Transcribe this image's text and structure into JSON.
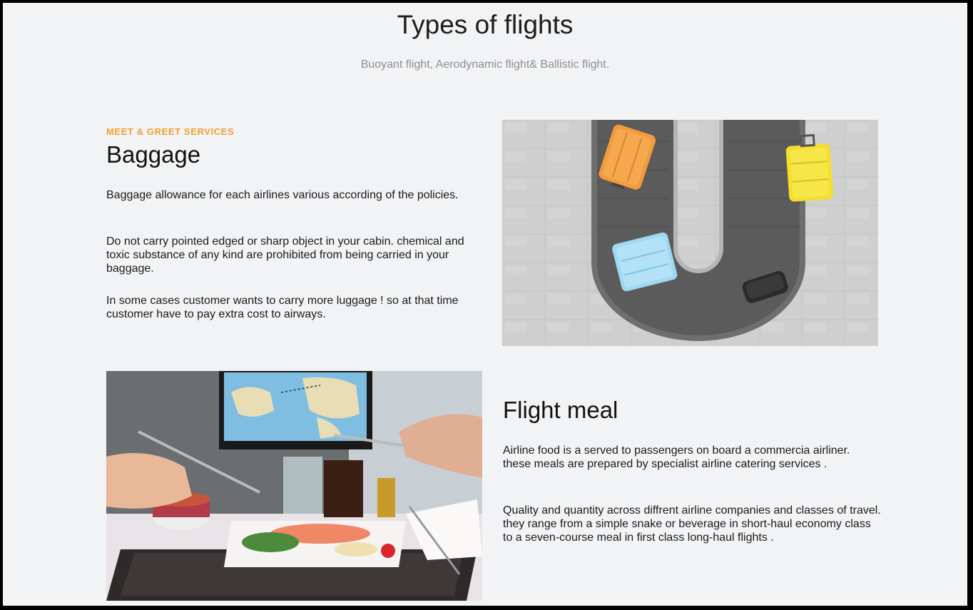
{
  "header": {
    "title": "Types of flights",
    "subtitle": "Buoyant flight, Aerodynamic flight& Ballistic flight."
  },
  "baggage": {
    "eyebrow": "MEET & GREET SERVICES",
    "title": "Baggage",
    "paragraphs": [
      "Baggage allowance for each airlines various according of the policies.",
      "Do not carry pointed edged or sharp object in your cabin. chemical and toxic substance of any kind are prohibited from being carried in your baggage.",
      "In some cases customer wants to carry more luggage ! so at that time customer have to pay extra cost to airways."
    ]
  },
  "meal": {
    "title": "Flight meal",
    "paragraphs": [
      "Airline food is a served to passengers on board a commercia airliner. these meals are prepared by specialist airline catering services .",
      "Quality and quantity across diffrent airline companies and classes of travel. they range from a simple snake or beverage in short-haul economy class to a seven-course meal in first class long-haul flights ."
    ]
  },
  "colors": {
    "accent": "#f0a030",
    "background": "#f2f3f5",
    "text": "#1a1a1a",
    "muted": "#8e8e8e"
  }
}
